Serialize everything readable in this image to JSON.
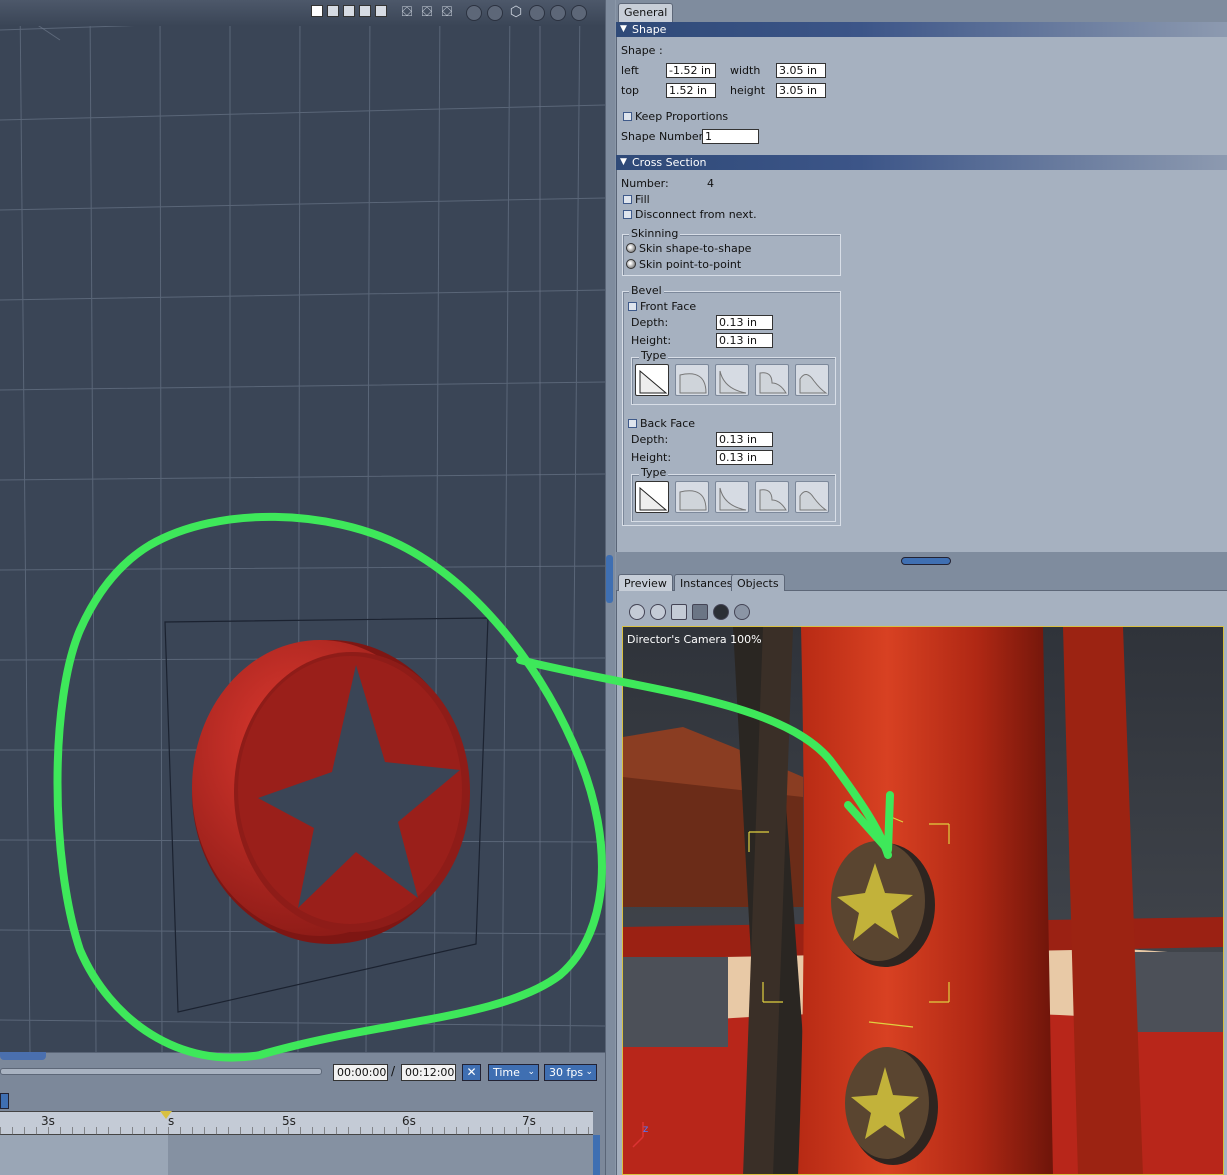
{
  "viewport": {
    "toolbar_icons": [
      "layout-single-icon",
      "layout-split-h-icon",
      "layout-split-v-icon",
      "layout-quad-icon",
      "layout-three-icon",
      "move-view-icon",
      "rotate-view-icon",
      "zoom-view-icon",
      "camera-icon",
      "pan-icon",
      "wireframe-cube-icon",
      "solid-cube-icon",
      "shaded-sphere-icon",
      "render-sphere-icon"
    ]
  },
  "timeline": {
    "current_time": "00:00:00",
    "slash": "/",
    "total_time": "00:12:00",
    "stop_icon": "✕",
    "mode": "Time",
    "fps": "30 fps",
    "ticks": [
      "3s",
      "s",
      "5s",
      "6s",
      "7s"
    ]
  },
  "props": {
    "tab": "General",
    "shape_section": "Shape",
    "shape_label": "Shape :",
    "left_label": "left",
    "left_value": "-1.52 in",
    "width_label": "width",
    "width_value": "3.05 in",
    "top_label": "top",
    "top_value": "1.52 in",
    "height_label": "height",
    "height_value": "3.05 in",
    "keep_proportions": "Keep Proportions",
    "shape_number_label": "Shape Number",
    "shape_number_value": "1",
    "cross_section": "Cross Section",
    "number_label": "Number:",
    "number_value": "4",
    "fill": "Fill",
    "disconnect": "Disconnect from next.",
    "skinning": "Skinning",
    "skin_shape": "Skin shape-to-shape",
    "skin_point": "Skin point-to-point",
    "bevel": "Bevel",
    "front_face": "Front Face",
    "back_face": "Back Face",
    "depth_label": "Depth:",
    "height2_label": "Height:",
    "front_depth": "0.13 in",
    "front_height": "0.13 in",
    "back_depth": "0.13 in",
    "back_height": "0.13 in",
    "type_label": "Type"
  },
  "preview": {
    "tabs": [
      "Preview",
      "Instances",
      "Objects"
    ],
    "camera_label": "Director's Camera 100%",
    "axis_label": "z"
  },
  "colors": {
    "viewport_bg": "#3a4556",
    "disc_red": "#b3231e",
    "annotation_green": "#3ee85a",
    "section_blue": "#2f4a78"
  }
}
